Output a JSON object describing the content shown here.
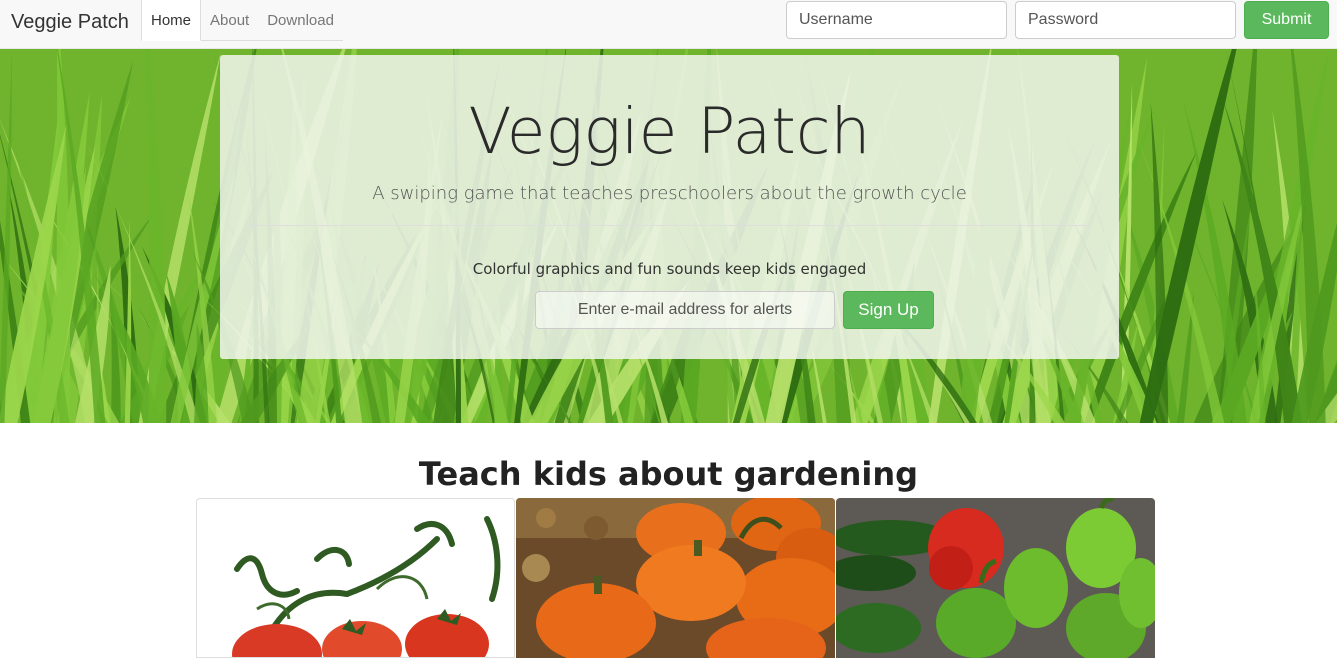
{
  "navbar": {
    "brand": "Veggie Patch",
    "tabs": [
      {
        "label": "Home",
        "active": true
      },
      {
        "label": "About",
        "active": false
      },
      {
        "label": "Download",
        "active": false
      }
    ],
    "username_placeholder": "Username",
    "password_placeholder": "Password",
    "submit_label": "Submit"
  },
  "hero": {
    "title": "Veggie Patch",
    "subtitle": "A swiping game that teaches preschoolers about the growth cycle",
    "blurb": "Colorful graphics and fun sounds keep kids engaged",
    "email_placeholder": "Enter e-mail address for alerts",
    "signup_label": "Sign Up"
  },
  "section": {
    "title": "Teach kids about gardening",
    "cards": [
      {
        "subject": "tomatoes"
      },
      {
        "subject": "pumpkins"
      },
      {
        "subject": "peppers"
      }
    ]
  },
  "colors": {
    "accent_green": "#5cb85c",
    "grass": "#6fb42c",
    "navbar_bg": "#f8f8f8"
  }
}
